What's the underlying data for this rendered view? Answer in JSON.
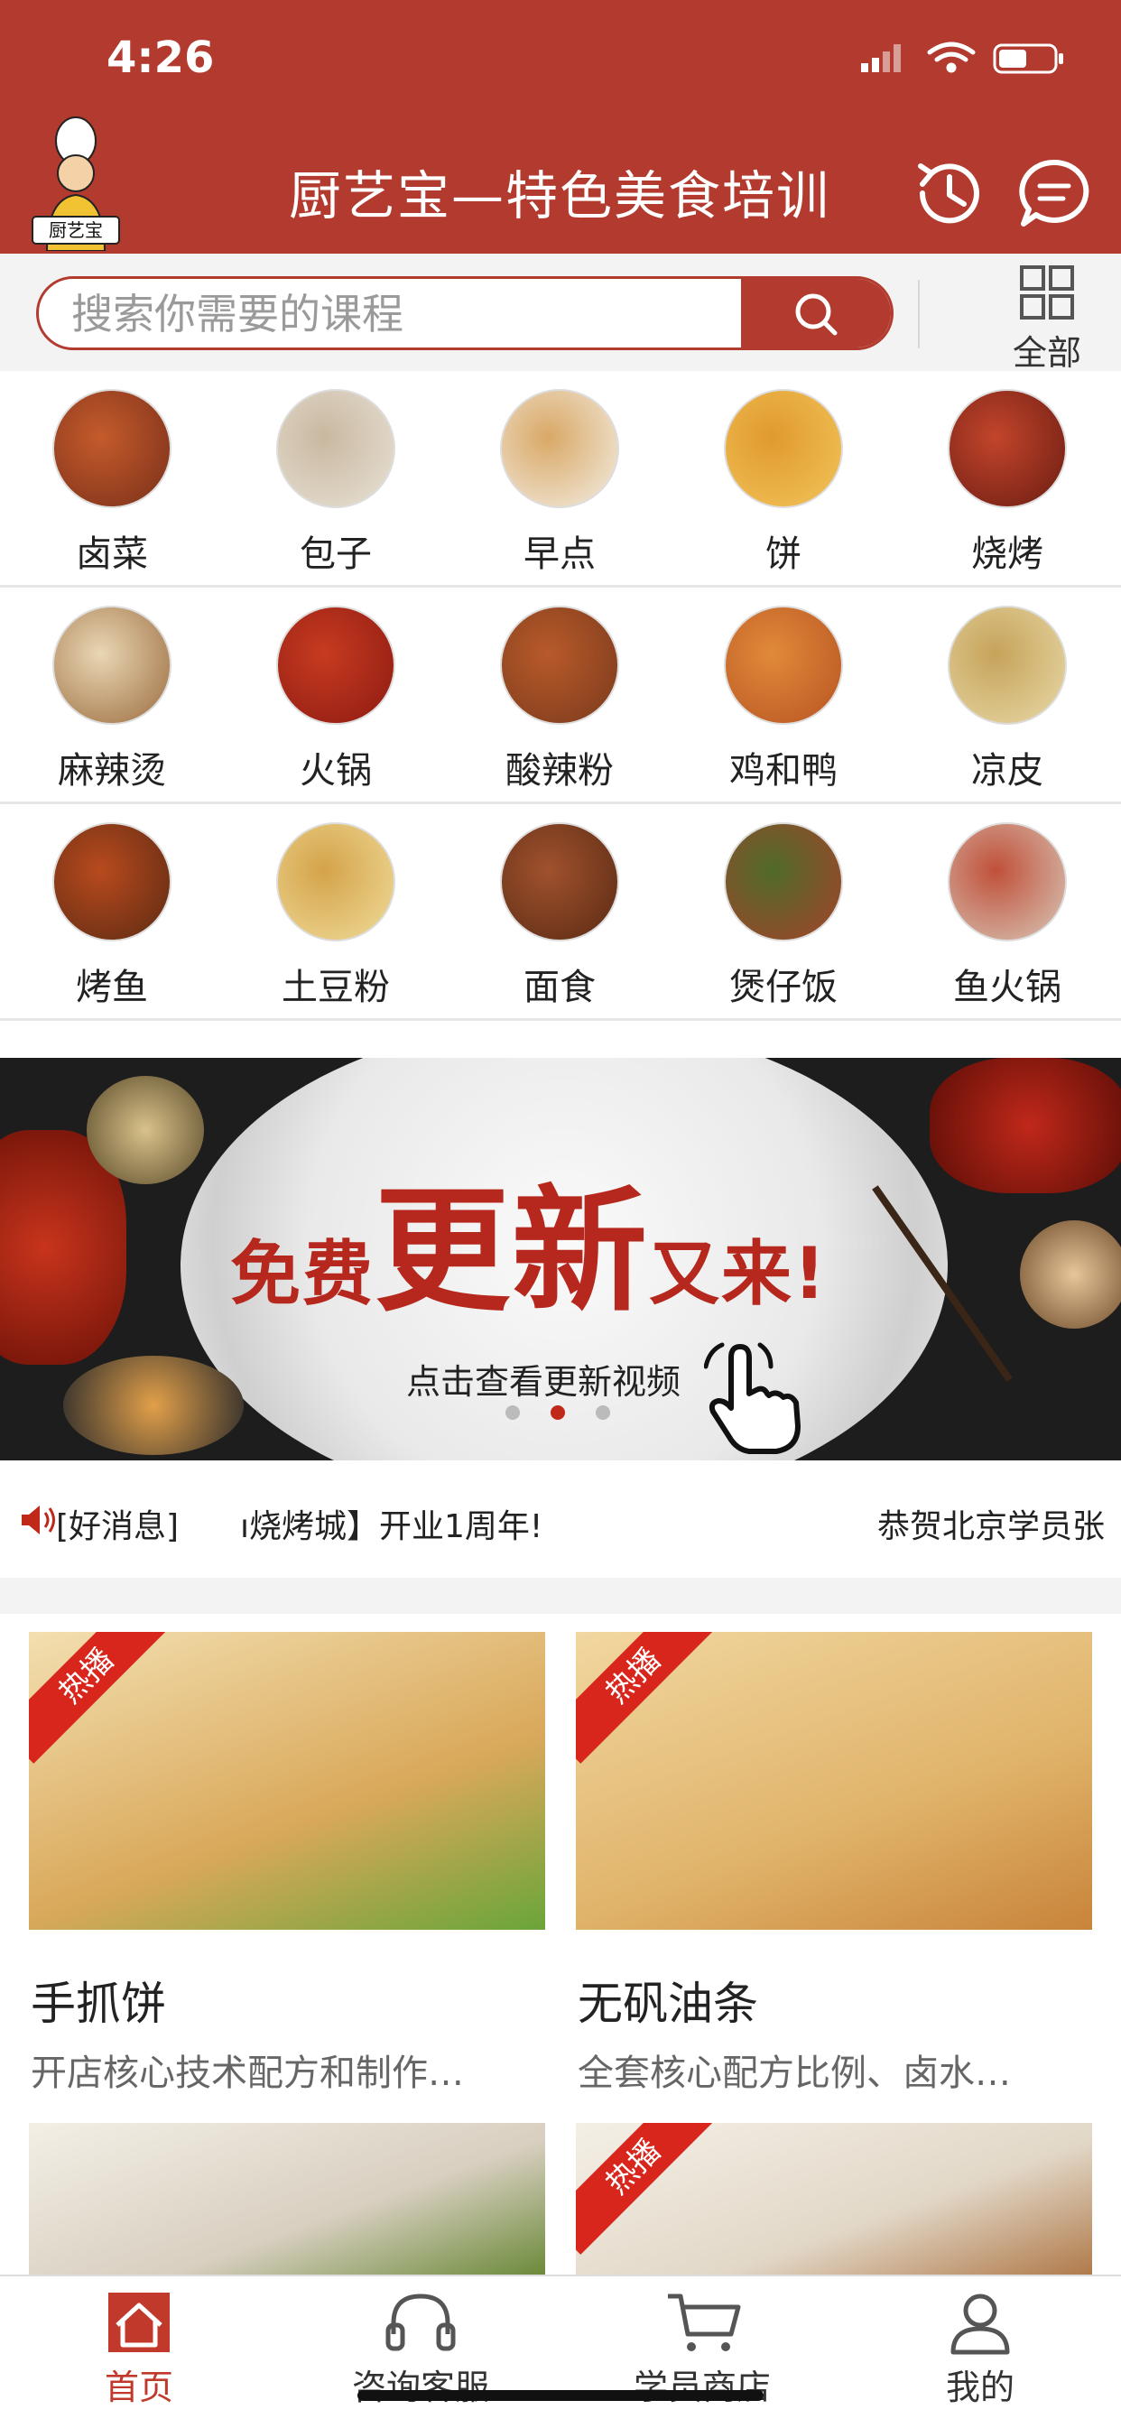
{
  "status_bar": {
    "time": "4:26"
  },
  "header": {
    "title": "厨艺宝—特色美食培训",
    "logo_text": "厨艺宝"
  },
  "search": {
    "placeholder": "搜索你需要的课程",
    "all_label": "全部"
  },
  "categories": [
    {
      "label": "卤菜",
      "colors": [
        "#7a2f1a",
        "#c45b2b"
      ]
    },
    {
      "label": "包子",
      "colors": [
        "#e8e2d6",
        "#c9b8a0"
      ]
    },
    {
      "label": "早点",
      "colors": [
        "#f3eee4",
        "#d9a866"
      ]
    },
    {
      "label": "饼",
      "colors": [
        "#f2c45a",
        "#e09a2e"
      ]
    },
    {
      "label": "烧烤",
      "colors": [
        "#6b1c12",
        "#c2452b"
      ]
    },
    {
      "label": "麻辣烫",
      "colors": [
        "#9b6b3e",
        "#e9d7b4"
      ]
    },
    {
      "label": "火锅",
      "colors": [
        "#8d1a12",
        "#c73b20"
      ]
    },
    {
      "label": "酸辣粉",
      "colors": [
        "#7a3a1c",
        "#b85a2a"
      ]
    },
    {
      "label": "鸡和鸭",
      "colors": [
        "#b85422",
        "#e08a3a"
      ]
    },
    {
      "label": "凉皮",
      "colors": [
        "#e8d9a8",
        "#c6a35a"
      ]
    },
    {
      "label": "烤鱼",
      "colors": [
        "#5c2a12",
        "#b84a1e"
      ]
    },
    {
      "label": "土豆粉",
      "colors": [
        "#f0dc9a",
        "#d4a34a"
      ]
    },
    {
      "label": "面食",
      "colors": [
        "#5a2a14",
        "#a0522d"
      ]
    },
    {
      "label": "煲仔饭",
      "colors": [
        "#a4432a",
        "#4f6b2a"
      ]
    },
    {
      "label": "鱼火锅",
      "colors": [
        "#d8c8b8",
        "#c0503a"
      ]
    }
  ],
  "banner": {
    "line1a": "免费",
    "line1b": "更新",
    "line1c": "又来!",
    "subtitle": "点击查看更新视频",
    "active_dot": 2,
    "dot_count": 3
  },
  "news": {
    "tag": "[好消息]",
    "text": "ı烧烤城】开业1周年!",
    "text2": "恭贺北京学员张"
  },
  "cards": [
    {
      "tag": "热播",
      "title": "手抓饼",
      "desc": "开店核心技术配方和制作…",
      "colors": [
        "#f3dfb0",
        "#d9a85a",
        "#6aa53a"
      ]
    },
    {
      "tag": "热播",
      "title": "无矾油条",
      "desc": "全套核心配方比例、卤水…",
      "colors": [
        "#f1d7a0",
        "#e0b36a",
        "#c8843a"
      ]
    },
    {
      "tag": "",
      "title": "",
      "desc": "",
      "colors": [
        "#f3efe6",
        "#d8cfc0",
        "#6c8a3a"
      ]
    },
    {
      "tag": "热播",
      "title": "",
      "desc": "",
      "colors": [
        "#f4efe6",
        "#e2d8c8",
        "#b07a4a"
      ]
    }
  ],
  "tabbar": [
    {
      "label": "首页",
      "active": true
    },
    {
      "label": "咨询客服",
      "active": false
    },
    {
      "label": "学员商店",
      "active": false
    },
    {
      "label": "我的",
      "active": false
    }
  ],
  "theme": {
    "primary": "#b23a2e",
    "hot_red": "#d8261c"
  }
}
